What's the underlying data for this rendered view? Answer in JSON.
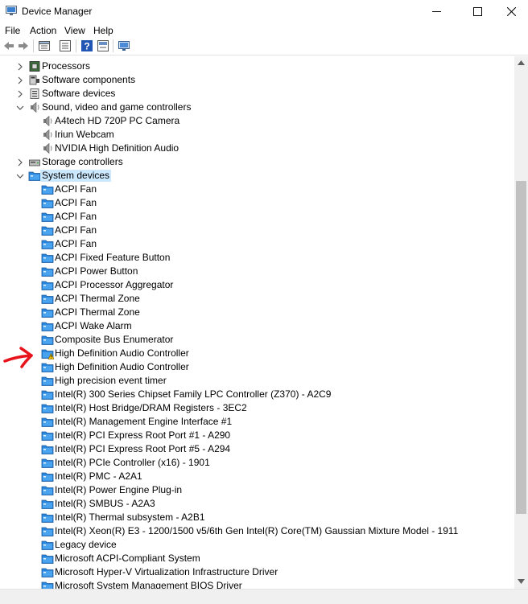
{
  "window": {
    "title": "Device Manager"
  },
  "menu": {
    "file": "File",
    "action": "Action",
    "view": "View",
    "help": "Help"
  },
  "toolbar": {
    "icons": [
      "back-icon",
      "forward-icon",
      "properties-sheet-icon",
      "list-icon",
      "help-icon",
      "refresh-icon",
      "monitor-icon"
    ]
  },
  "tree": {
    "rows": [
      {
        "label": "Processors",
        "level": 1,
        "expander": "collapsed",
        "icon": "processor"
      },
      {
        "label": "Software components",
        "level": 1,
        "expander": "collapsed",
        "icon": "software-component"
      },
      {
        "label": "Software devices",
        "level": 1,
        "expander": "collapsed",
        "icon": "software-device"
      },
      {
        "label": "Sound, video and game controllers",
        "level": 1,
        "expander": "expanded",
        "icon": "speaker"
      },
      {
        "label": "A4tech HD 720P PC Camera",
        "level": 2,
        "icon": "speaker"
      },
      {
        "label": "Iriun Webcam",
        "level": 2,
        "icon": "speaker"
      },
      {
        "label": "NVIDIA High Definition Audio",
        "level": 2,
        "icon": "speaker"
      },
      {
        "label": "Storage controllers",
        "level": 1,
        "expander": "collapsed",
        "icon": "storage"
      },
      {
        "label": "System devices",
        "level": 1,
        "expander": "expanded",
        "icon": "folder",
        "selected": true
      },
      {
        "label": "ACPI Fan",
        "level": 2,
        "icon": "folder"
      },
      {
        "label": "ACPI Fan",
        "level": 2,
        "icon": "folder"
      },
      {
        "label": "ACPI Fan",
        "level": 2,
        "icon": "folder"
      },
      {
        "label": "ACPI Fan",
        "level": 2,
        "icon": "folder"
      },
      {
        "label": "ACPI Fan",
        "level": 2,
        "icon": "folder"
      },
      {
        "label": "ACPI Fixed Feature Button",
        "level": 2,
        "icon": "folder"
      },
      {
        "label": "ACPI Power Button",
        "level": 2,
        "icon": "folder"
      },
      {
        "label": "ACPI Processor Aggregator",
        "level": 2,
        "icon": "folder"
      },
      {
        "label": "ACPI Thermal Zone",
        "level": 2,
        "icon": "folder"
      },
      {
        "label": "ACPI Thermal Zone",
        "level": 2,
        "icon": "folder"
      },
      {
        "label": "ACPI Wake Alarm",
        "level": 2,
        "icon": "folder"
      },
      {
        "label": "Composite Bus Enumerator",
        "level": 2,
        "icon": "folder"
      },
      {
        "label": "High Definition Audio Controller",
        "level": 2,
        "icon": "warning"
      },
      {
        "label": "High Definition Audio Controller",
        "level": 2,
        "icon": "folder"
      },
      {
        "label": "High precision event timer",
        "level": 2,
        "icon": "folder"
      },
      {
        "label": "Intel(R) 300 Series Chipset Family LPC Controller (Z370) - A2C9",
        "level": 2,
        "icon": "folder"
      },
      {
        "label": "Intel(R) Host Bridge/DRAM Registers - 3EC2",
        "level": 2,
        "icon": "folder"
      },
      {
        "label": "Intel(R) Management Engine Interface #1",
        "level": 2,
        "icon": "folder"
      },
      {
        "label": "Intel(R) PCI Express Root Port #1 - A290",
        "level": 2,
        "icon": "folder"
      },
      {
        "label": "Intel(R) PCI Express Root Port #5 - A294",
        "level": 2,
        "icon": "folder"
      },
      {
        "label": "Intel(R) PCIe Controller (x16) - 1901",
        "level": 2,
        "icon": "folder"
      },
      {
        "label": "Intel(R) PMC - A2A1",
        "level": 2,
        "icon": "folder"
      },
      {
        "label": "Intel(R) Power Engine Plug-in",
        "level": 2,
        "icon": "folder"
      },
      {
        "label": "Intel(R) SMBUS - A2A3",
        "level": 2,
        "icon": "folder"
      },
      {
        "label": "Intel(R) Thermal subsystem - A2B1",
        "level": 2,
        "icon": "folder"
      },
      {
        "label": "Intel(R) Xeon(R) E3 - 1200/1500 v5/6th Gen Intel(R) Core(TM) Gaussian Mixture Model - 1911",
        "level": 2,
        "icon": "folder"
      },
      {
        "label": "Legacy device",
        "level": 2,
        "icon": "folder"
      },
      {
        "label": "Microsoft ACPI-Compliant System",
        "level": 2,
        "icon": "folder"
      },
      {
        "label": "Microsoft Hyper-V Virtualization Infrastructure Driver",
        "level": 2,
        "icon": "folder"
      },
      {
        "label": "Microsoft System Management BIOS Driver",
        "level": 2,
        "icon": "folder"
      }
    ]
  },
  "colors": {
    "selection": "#cce8ff",
    "annotation": "#e8141c",
    "folder": "#1e73c8"
  }
}
